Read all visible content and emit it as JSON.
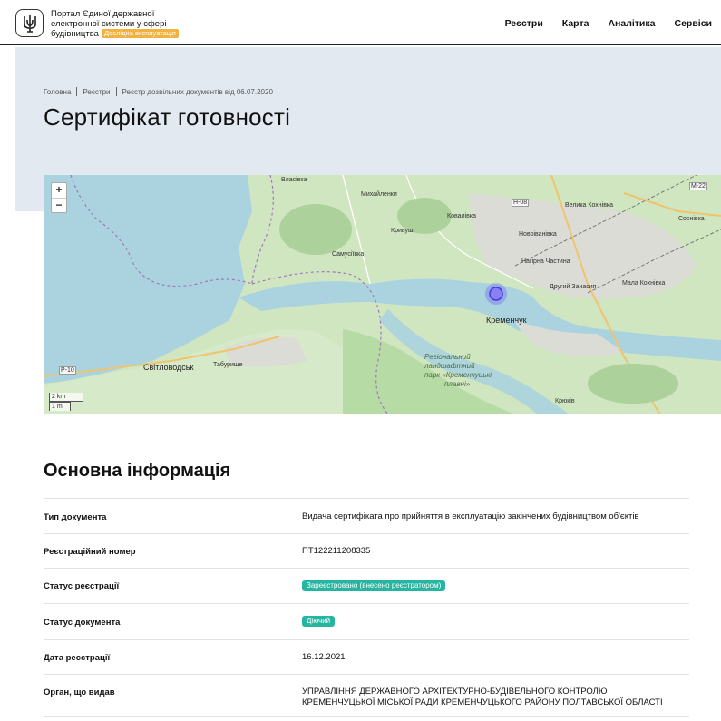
{
  "header": {
    "brand_line1": "Портал Єдиної державної",
    "brand_line2": "електронної системи у сфері",
    "brand_line3": "будівництва",
    "beta_badge": "Дослідна експлуатація",
    "nav": [
      "Реєстри",
      "Карта",
      "Аналітика",
      "Сервіси"
    ]
  },
  "breadcrumb": [
    "Головна",
    "Реєстри",
    "Реєстр дозвільних документів від 06.07.2020"
  ],
  "page_title": "Сертифікат готовності",
  "map": {
    "zoom_in": "+",
    "zoom_out": "−",
    "scale_km": "2 km",
    "scale_mi": "1 mi",
    "labels": {
      "vlasivka": "Власівка",
      "mykhailenky": "Михайленки",
      "kovalivka": "Ковалівка",
      "kryvushi": "Кривуші",
      "samusiivka": "Самусіївка",
      "velyka_kokhnivka": "Велика Кохнівка",
      "novoivanivka": "Новоіванівка",
      "naprna_chastyna": "Нагірна Частина",
      "malа_kokhnivka": "Мала Кохнівка",
      "druhyi_zanasyp": "Другий Занасип",
      "kremenchuk": "Кременчук",
      "svitlovodsk": "Світловодськ",
      "tabyrysche": "Табурище",
      "sosnivka": "Соснівка",
      "kriukiv": "Крюків",
      "park_line1": "Регіональний",
      "park_line2": "ландшафтний",
      "park_line3": "парк «Кременчуцькі",
      "park_line4": "плавні»",
      "road_m22": "М-22",
      "road_h08": "Н-08",
      "road_p10": "Р-10"
    }
  },
  "main": {
    "section_title": "Основна інформація",
    "rows": [
      {
        "key": "Тип документа",
        "value": "Видача сертифіката про прийняття в експлуатацію закінчених будівництвом об'єктів"
      },
      {
        "key": "Реєстраційний номер",
        "value": "ПТ122211208335"
      },
      {
        "key": "Статус реєстрації",
        "value": "Зареєстровано (внесено реєстратором)"
      },
      {
        "key": "Статус документа",
        "value": "Діючий"
      },
      {
        "key": "Дата реєстрації",
        "value": "16.12.2021"
      },
      {
        "key": "Орган, що видав",
        "value_line1": "УПРАВЛІННЯ ДЕРЖАВНОГО АРХІТЕКТУРНО-БУДІВЕЛЬНОГО КОНТРОЛЮ",
        "value_line2": "КРЕМЕНЧУЦЬКОЇ МІСЬКОЇ РАДИ КРЕМЕНЧУЦЬКОГО РАЙОНУ ПОЛТАВСЬКОЇ ОБЛАСТІ"
      }
    ]
  },
  "colors": {
    "hero_bg": "#e3e9f1",
    "status_pill": "#25b5a0",
    "beta_badge": "#f2b241",
    "map_water": "#aad3df",
    "map_land": "#c6e2b6",
    "marker": "#6a5cf0"
  }
}
